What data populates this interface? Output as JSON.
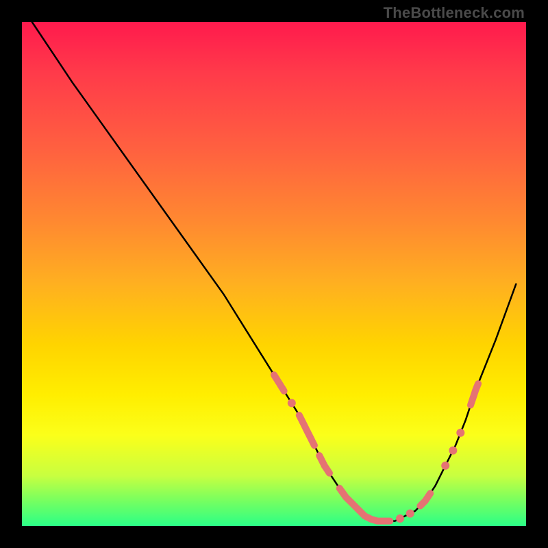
{
  "watermark": "TheBottleneck.com",
  "colors": {
    "marker": "#e57373",
    "curve": "#000000"
  },
  "chart_data": {
    "type": "line",
    "title": "",
    "xlabel": "",
    "ylabel": "",
    "xlim": [
      0,
      100
    ],
    "ylim": [
      0,
      100
    ],
    "note": "x is relative horizontal position (percent of plot width); y is relative height (percent of plot height, 0 = bottom green, 100 = top red). Values are estimated from gridless figure.",
    "series": [
      {
        "name": "bottleneck-curve",
        "x": [
          2,
          6,
          10,
          15,
          20,
          25,
          30,
          35,
          40,
          45,
          50,
          55,
          58,
          60,
          62,
          64,
          66,
          68,
          70,
          72,
          74,
          76,
          78,
          80,
          82,
          84,
          86,
          88,
          90,
          94,
          98
        ],
        "y": [
          100,
          94,
          88,
          81,
          74,
          67,
          60,
          53,
          46,
          38,
          30,
          22,
          16,
          12,
          9,
          6,
          4,
          2,
          1,
          1,
          1,
          2,
          3,
          5,
          8,
          12,
          16,
          21,
          27,
          37,
          48
        ]
      }
    ],
    "markers": [
      {
        "name": "segment",
        "x0": 50,
        "x1": 52,
        "note": "short salmon dash on left descending arm"
      },
      {
        "name": "dot",
        "x": 53.5
      },
      {
        "name": "segment",
        "x0": 55,
        "x1": 58
      },
      {
        "name": "segment",
        "x0": 59,
        "x1": 61
      },
      {
        "name": "segment",
        "x0": 63,
        "x1": 73,
        "note": "long bottom run"
      },
      {
        "name": "dot",
        "x": 75
      },
      {
        "name": "dot",
        "x": 77
      },
      {
        "name": "segment",
        "x0": 79,
        "x1": 81
      },
      {
        "name": "dot",
        "x": 84
      },
      {
        "name": "dot",
        "x": 85.5
      },
      {
        "name": "dot",
        "x": 87
      },
      {
        "name": "segment",
        "x0": 89,
        "x1": 90.5
      }
    ]
  }
}
